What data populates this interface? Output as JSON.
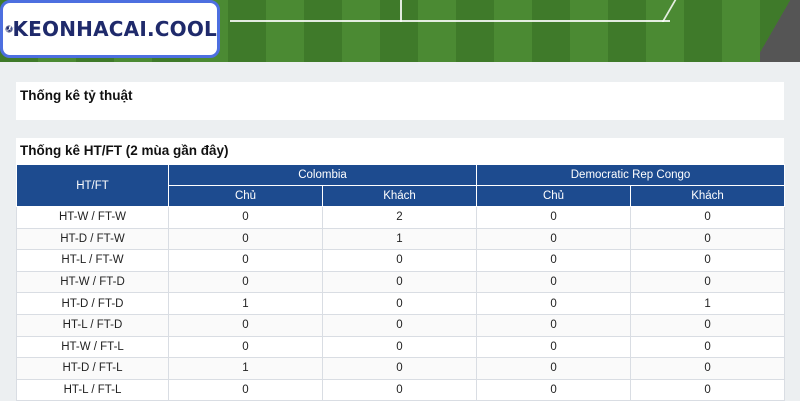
{
  "brand": {
    "logo_text": "KEONHACAI.COOL"
  },
  "odds_panel": {
    "title": "Thống kê tỷ thuật"
  },
  "htft_panel": {
    "title": "Thống kê HT/FT (2 mùa gần đây)",
    "corner_header": "HT/FT",
    "teams": [
      "Colombia",
      "Democratic Rep Congo"
    ],
    "sub_headers": [
      "Chủ",
      "Khách",
      "Chủ",
      "Khách"
    ],
    "rows": [
      {
        "label": "HT-W / FT-W",
        "values": [
          "0",
          "2",
          "0",
          "0"
        ]
      },
      {
        "label": "HT-D / FT-W",
        "values": [
          "0",
          "1",
          "0",
          "0"
        ]
      },
      {
        "label": "HT-L / FT-W",
        "values": [
          "0",
          "0",
          "0",
          "0"
        ]
      },
      {
        "label": "HT-W / FT-D",
        "values": [
          "0",
          "0",
          "0",
          "0"
        ]
      },
      {
        "label": "HT-D / FT-D",
        "values": [
          "1",
          "0",
          "0",
          "1"
        ]
      },
      {
        "label": "HT-L / FT-D",
        "values": [
          "0",
          "0",
          "0",
          "0"
        ]
      },
      {
        "label": "HT-W / FT-L",
        "values": [
          "0",
          "0",
          "0",
          "0"
        ]
      },
      {
        "label": "HT-D / FT-L",
        "values": [
          "1",
          "0",
          "0",
          "0"
        ]
      },
      {
        "label": "HT-L / FT-L",
        "values": [
          "0",
          "0",
          "0",
          "0"
        ]
      }
    ]
  },
  "colors": {
    "header_blue": "#1d4b8f",
    "logo_border": "#4d6fe0",
    "pitch_green": "#3f7a2a"
  }
}
